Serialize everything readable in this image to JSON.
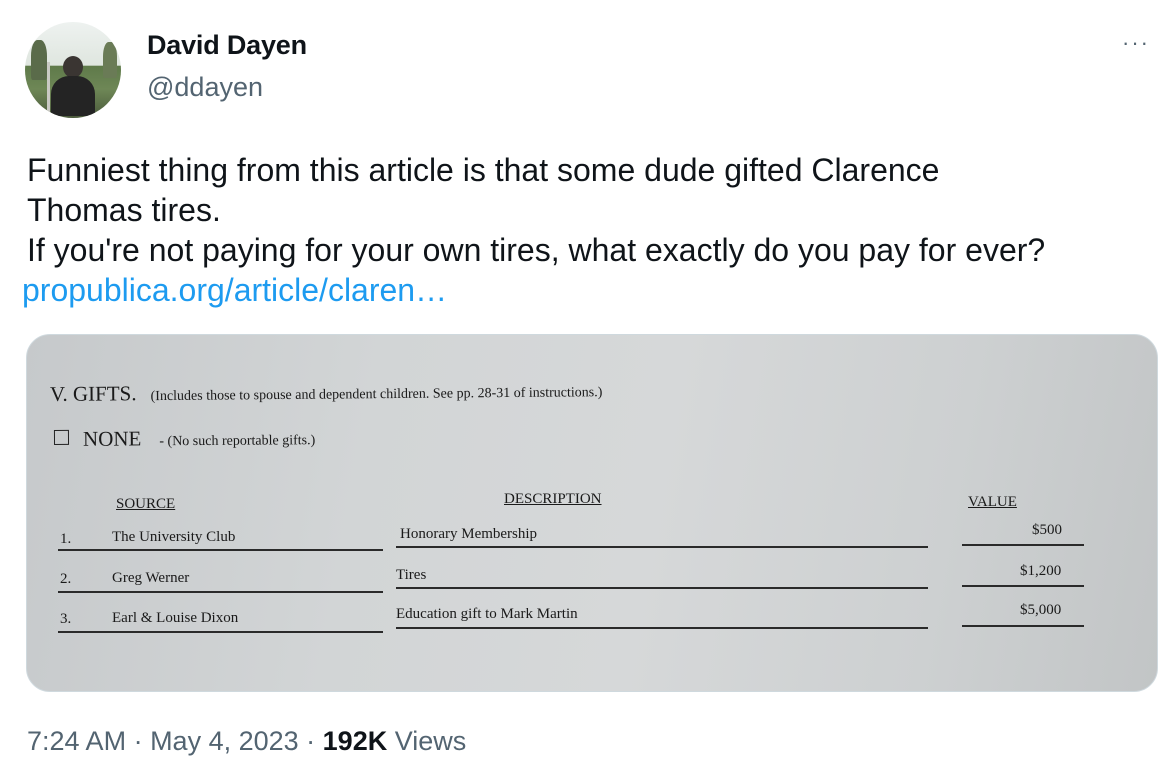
{
  "author": {
    "name": "David Dayen",
    "handle": "@ddayen"
  },
  "more_label": "···",
  "tweet": {
    "line1": "Funniest thing from this article is that some dude gifted Clarence",
    "line2": "Thomas tires.",
    "line3": "If you're not paying for your own tires, what exactly do you pay for ever?",
    "link": "propublica.org/article/claren…"
  },
  "document": {
    "section_title": "V.  GIFTS.",
    "section_note": "(Includes those to spouse and dependent children.  See pp. 28-31 of instructions.)",
    "none_label": "NONE",
    "none_note": "-  (No such reportable gifts.)",
    "columns": {
      "source": "SOURCE",
      "description": "DESCRIPTION",
      "value": "VALUE"
    },
    "rows": [
      {
        "num": "1.",
        "source": "The University Club",
        "description": "Honorary Membership",
        "value": "$500"
      },
      {
        "num": "2.",
        "source": "Greg Werner",
        "description": "Tires",
        "value": "$1,200"
      },
      {
        "num": "3.",
        "source": "Earl & Louise Dixon",
        "description": "Education gift to Mark Martin",
        "value": "$5,000"
      }
    ]
  },
  "meta": {
    "time": "7:24 AM",
    "sep1": " · ",
    "date": "May 4, 2023",
    "sep2": " · ",
    "views_count": "192K",
    "views_label": " Views"
  }
}
